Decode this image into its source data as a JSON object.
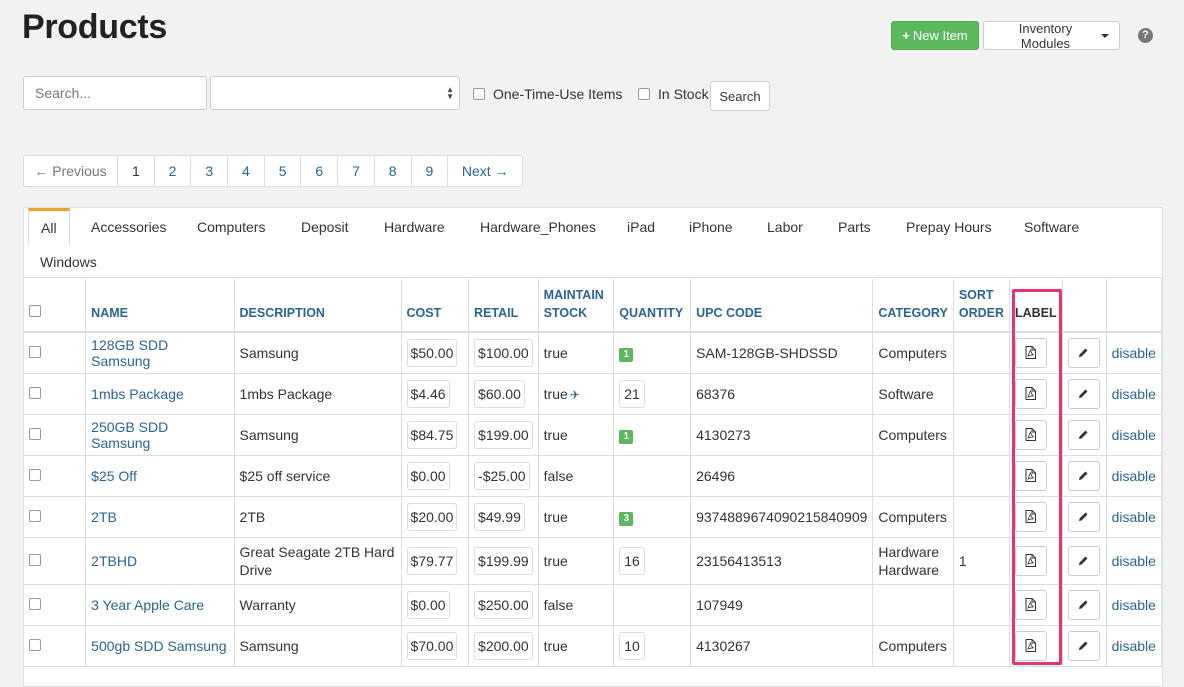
{
  "header": {
    "title": "Products",
    "new_item_label": "New Item",
    "modules_label": "Inventory Modules",
    "help_symbol": "?"
  },
  "filters": {
    "search_placeholder": "Search...",
    "one_time_label": "One-Time-Use Items",
    "in_stock_label": "In Stock",
    "search_button": "Search"
  },
  "pagination": {
    "prev": "← Previous",
    "pages": [
      "1",
      "2",
      "3",
      "4",
      "5",
      "6",
      "7",
      "8",
      "9"
    ],
    "current": "1",
    "next": "Next →"
  },
  "tabs": [
    "All",
    "Accessories",
    "Computers",
    "Deposit",
    "Hardware",
    "Hardware_Phones",
    "iPad",
    "iPhone",
    "Labor",
    "Parts",
    "Prepay Hours",
    "Software",
    "Windows"
  ],
  "columns": {
    "name": "NAME",
    "description": "DESCRIPTION",
    "cost": "COST",
    "retail": "RETAIL",
    "maintain_stock": "MAINTAIN STOCK",
    "quantity": "QUANTITY",
    "upc": "UPC CODE",
    "category": "CATEGORY",
    "sort_order": "SORT ORDER",
    "label": "LABEL"
  },
  "rows": [
    {
      "name": "128GB SDD Samsung",
      "description": "Samsung",
      "cost": "$50.00",
      "retail": "$100.00",
      "maintain": "true",
      "qty": "1",
      "qty_style": "badge",
      "upc": "SAM-128GB-SHDSSD",
      "category": "Computers",
      "sort": "",
      "action": "disable"
    },
    {
      "name": "1mbs Package",
      "description": "1mbs Package",
      "cost": "$4.46",
      "retail": "$60.00",
      "maintain": "true",
      "plane": true,
      "qty": "21",
      "qty_style": "box",
      "upc": "68376",
      "category": "Software",
      "sort": "",
      "action": "disable"
    },
    {
      "name": "250GB SDD Samsung",
      "description": "Samsung",
      "cost": "$84.75",
      "retail": "$199.00",
      "maintain": "true",
      "qty": "1",
      "qty_style": "badge",
      "upc": "4130273",
      "category": "Computers",
      "sort": "",
      "action": "disable"
    },
    {
      "name": "$25 Off",
      "description": "$25 off service",
      "cost": "$0.00",
      "retail": "-$25.00",
      "maintain": "false",
      "qty": "",
      "qty_style": "none",
      "upc": "26496",
      "category": "",
      "sort": "",
      "action": "disable"
    },
    {
      "name": "2TB",
      "description": "2TB",
      "cost": "$20.00",
      "retail": "$49.99",
      "maintain": "true",
      "qty": "3",
      "qty_style": "badge",
      "upc": "937488967409021584090​9",
      "category": "Computers",
      "sort": "",
      "action": "disable"
    },
    {
      "name": "2TBHD",
      "description": "Great Seagate 2TB Hard Drive",
      "cost": "$79.77",
      "retail": "$199.99",
      "maintain": "true",
      "qty": "16",
      "qty_style": "box",
      "upc": "23156413513",
      "category": "Hardware Hardware",
      "sort": "1",
      "action": "disable"
    },
    {
      "name": "3 Year Apple Care",
      "description": "Warranty",
      "cost": "$0.00",
      "retail": "$250.00",
      "maintain": "false",
      "qty": "",
      "qty_style": "none",
      "upc": "107949",
      "category": "",
      "sort": "",
      "action": "disable"
    },
    {
      "name": "500gb SDD Samsung",
      "description": "Samsung",
      "cost": "$70.00",
      "retail": "$200.00",
      "maintain": "true",
      "qty": "10",
      "qty_style": "box",
      "upc": "4130267",
      "category": "Computers",
      "sort": "",
      "action": "disable"
    }
  ],
  "colors": {
    "link": "#2a6496",
    "success": "#5cb85c",
    "tab_accent": "#f0a030",
    "highlight": "#e8336d"
  },
  "icons": {
    "label_icon": "pdf-file-icon",
    "edit_icon": "pencil-icon",
    "maintain_extra_icon": "airplane-icon"
  }
}
